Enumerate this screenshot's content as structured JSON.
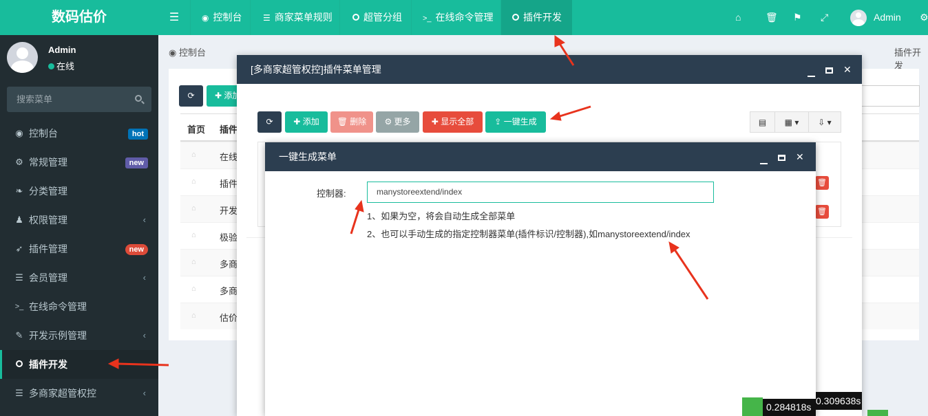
{
  "app": {
    "logo": "数码估价"
  },
  "user": {
    "name": "Admin",
    "status": "在线"
  },
  "search": {
    "placeholder": "搜索菜单"
  },
  "sidebar": {
    "items": [
      {
        "label": "控制台",
        "icon": "dashboard-icon",
        "badge": "hot",
        "badge_color": "#0073b7"
      },
      {
        "label": "常规管理",
        "icon": "cogs-icon",
        "badge": "new",
        "badge_color": "#605ca8"
      },
      {
        "label": "分类管理",
        "icon": "leaf-icon"
      },
      {
        "label": "权限管理",
        "icon": "group-icon",
        "chevron": "‹"
      },
      {
        "label": "插件管理",
        "icon": "rocket-icon",
        "badge": "new",
        "badge_color": "#dd4b39"
      },
      {
        "label": "会员管理",
        "icon": "list-icon",
        "chevron": "‹"
      },
      {
        "label": "在线命令管理",
        "icon": "terminal-icon"
      },
      {
        "label": "开发示例管理",
        "icon": "magic-icon",
        "chevron": "‹"
      },
      {
        "label": "插件开发",
        "icon": "circle-icon",
        "active": true
      },
      {
        "label": "多商家超管权控",
        "icon": "list-icon",
        "chevron": "‹"
      }
    ]
  },
  "topnav": {
    "tabs": [
      {
        "label": "控制台",
        "icon": "dashboard-icon"
      },
      {
        "label": "商家菜单规则",
        "icon": "list-icon"
      },
      {
        "label": "超管分组",
        "icon": "circle-icon"
      },
      {
        "label": "在线命令管理",
        "icon": "terminal-icon"
      },
      {
        "label": "插件开发",
        "icon": "circle-icon",
        "active": true
      }
    ],
    "user": "Admin"
  },
  "content": {
    "breadcrumb": "控制台",
    "breadcrumb_right": "插件开发",
    "add_label": "添加",
    "table_headers": [
      "首页",
      "插件"
    ],
    "rows": [
      "在线",
      "插件",
      "开发",
      "极验",
      "多商",
      "多商",
      "估价"
    ]
  },
  "dialog_main": {
    "title": "[多商家超管权控]插件菜单管理",
    "buttons": {
      "add": "添加",
      "delete": "删除",
      "more": "更多",
      "show_all": "显示全部",
      "generate": "一键生成"
    }
  },
  "dialog_gen": {
    "title": "一键生成菜单",
    "field_label": "控制器:",
    "field_value": "manystoreextend/index",
    "hint1": "1、如果为空，将会自动生成全部菜单",
    "hint2": "2、也可以手动生成的指定控制器菜单(插件标识/控制器),如manystoreextend/index"
  },
  "timers": {
    "t1": "0.284818s",
    "t2": "0.309638s"
  },
  "colors": {
    "brand": "#18bc9c",
    "sidebar": "#222d32",
    "dialog_header": "#2c3e50",
    "danger": "#e74c3c",
    "arrow": "#e8331d"
  }
}
